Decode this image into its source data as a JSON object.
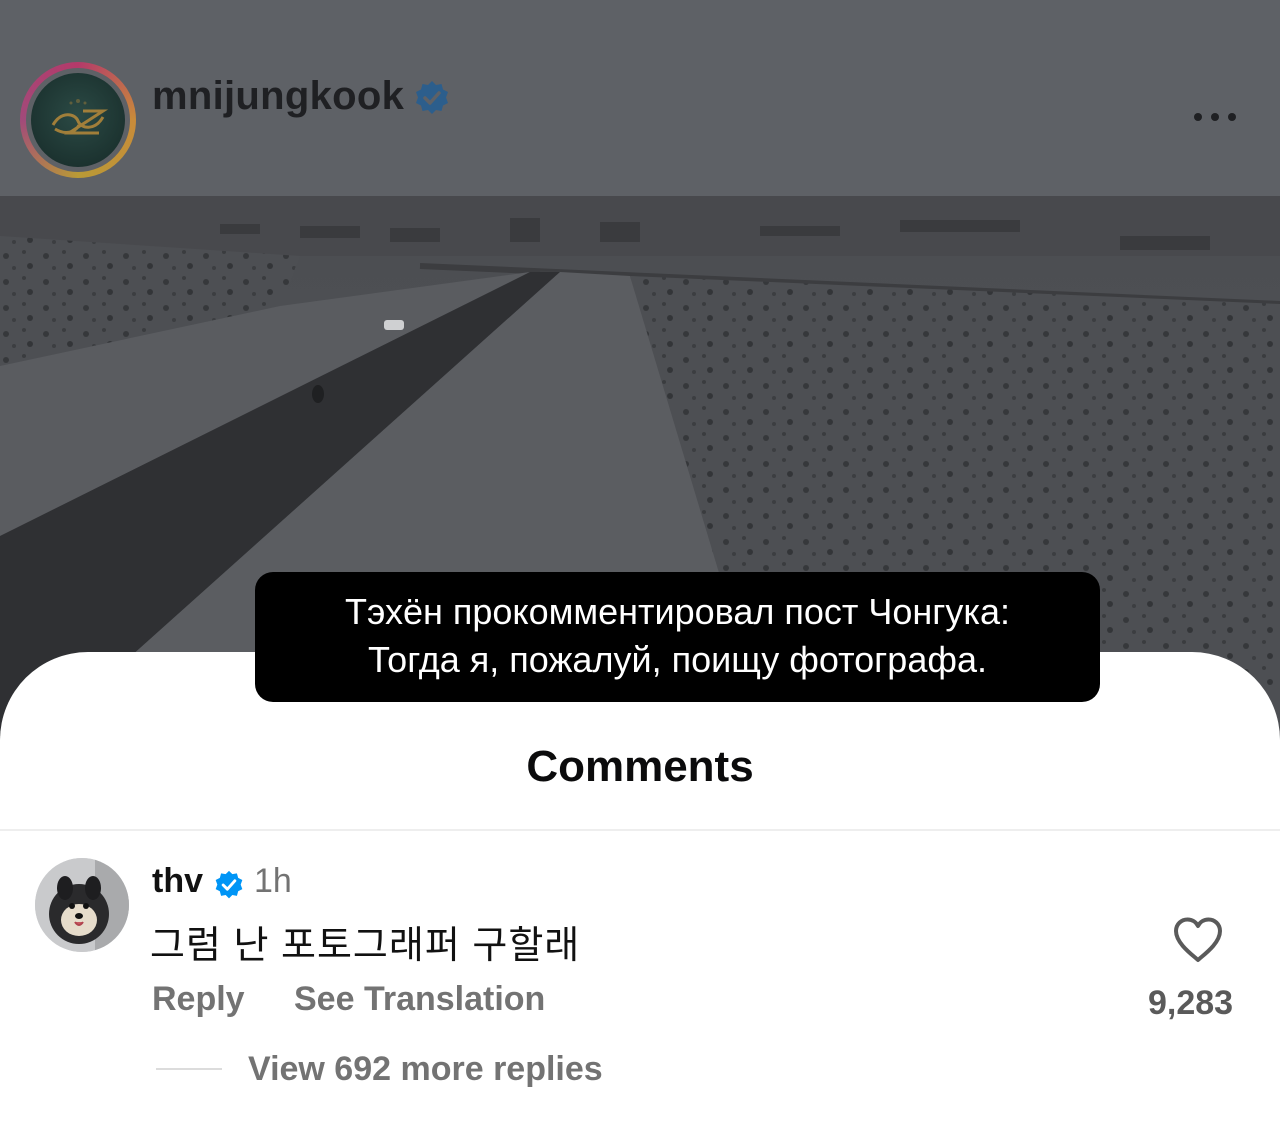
{
  "header": {
    "username": "mnijungkook",
    "verified": true
  },
  "caption": {
    "line1": "Тэхён прокомментировал пост Чонгука:",
    "line2": "Тогда я, пожалуй, поищу фотографа."
  },
  "comments_sheet": {
    "title": "Comments",
    "comment": {
      "username": "thv",
      "verified": true,
      "time": "1h",
      "text": "그럼 난 포토그래퍼 구할래",
      "reply_label": "Reply",
      "translate_label": "See Translation",
      "likes": "9,283",
      "view_replies_label": "View 692 more replies"
    }
  },
  "colors": {
    "verified_blue": "#0095f6",
    "overlay_header": "#5e6166",
    "caption_bg": "#000000",
    "secondary_text": "#737373"
  },
  "icons": {
    "more": "more-horizontal-icon",
    "verified": "verified-badge-icon",
    "like": "heart-outline-icon"
  }
}
